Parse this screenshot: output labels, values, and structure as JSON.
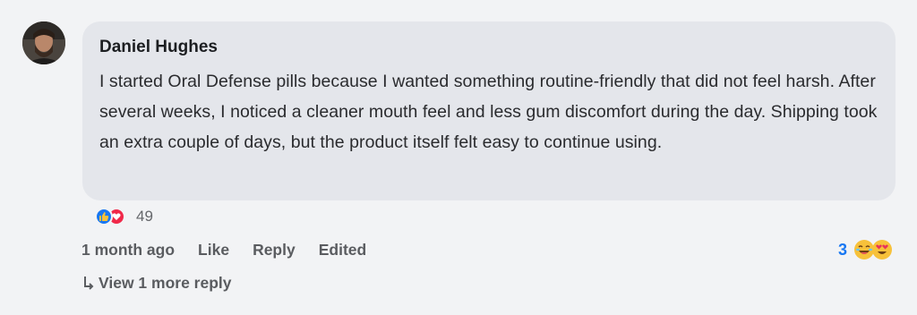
{
  "comment": {
    "author": "Daniel Hughes",
    "text": "I started Oral Defense pills because I wanted something routine-friendly that did not feel harsh. After several weeks, I noticed a cleaner mouth feel and less gum discomfort during the day. Shipping took an extra couple of days, but the product itself felt easy to continue using.",
    "reactions": {
      "icons": [
        "like-icon",
        "love-icon"
      ],
      "count": "49"
    },
    "time": "1 month ago",
    "like_label": "Like",
    "reply_label": "Reply",
    "edited_label": "Edited",
    "reply_reactions": {
      "count": "3",
      "icons": [
        "laughing-emoji-icon",
        "heart-eyes-emoji-icon"
      ]
    },
    "view_more_label": "View 1 more reply"
  },
  "colors": {
    "background": "#f2f3f5",
    "bubble": "#e4e6eb",
    "like_blue": "#1877f2",
    "love_red": "#f02849",
    "muted_text": "#65676b"
  }
}
